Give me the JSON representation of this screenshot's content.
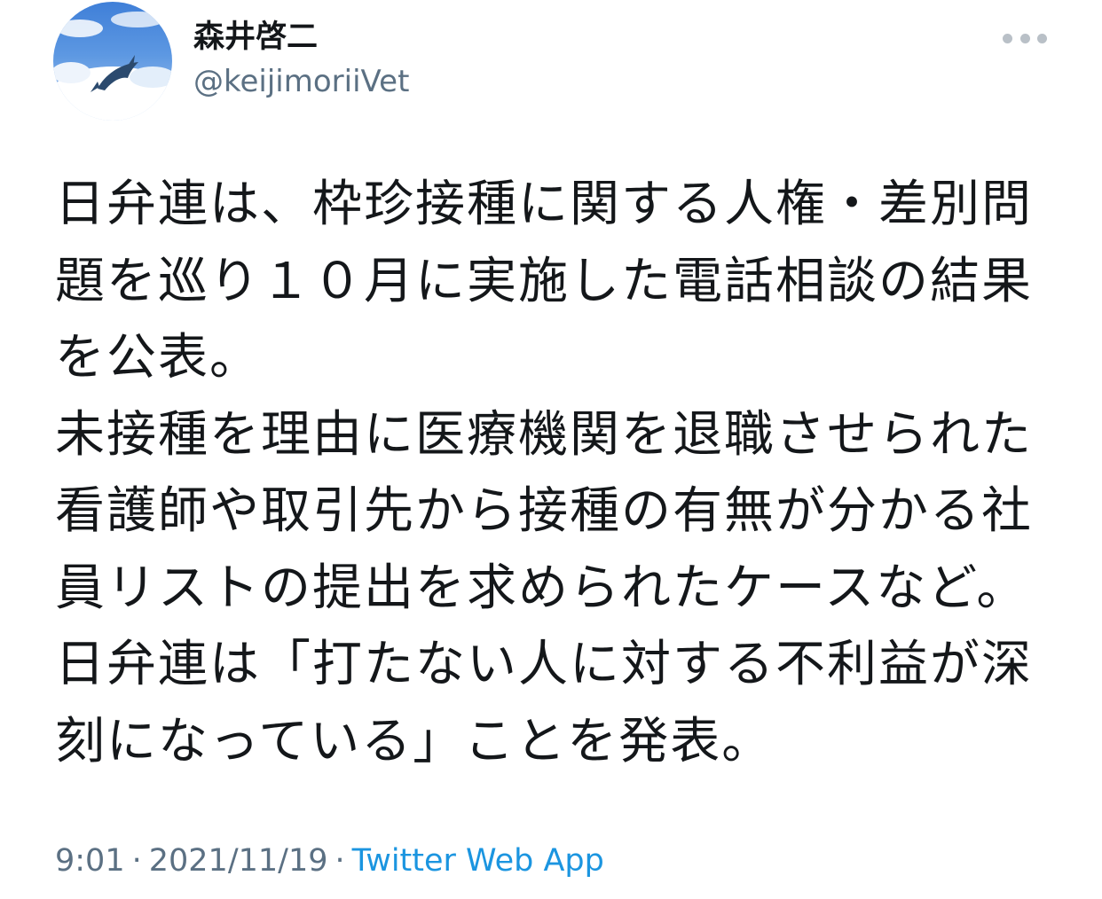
{
  "author": {
    "display_name": "森井啓二",
    "handle": "@keijimoriiVet",
    "avatar_icon": "dolphin-avatar-icon"
  },
  "more_icon": "more-options-icon",
  "tweet": {
    "text": "日弁連は、枠珍接種に関する人権・差別問題を巡り１０月に実施した電話相談の結果を公表。\n未接種を理由に医療機関を退職させられた看護師や取引先から接種の有無が分かる社員リストの提出を求められたケースなど。\n日弁連は「打たない人に対する不利益が深刻になっている」ことを発表。"
  },
  "meta": {
    "time": "9:01",
    "separator": "·",
    "date": "2021/11/19",
    "source": "Twitter Web App"
  },
  "colors": {
    "text": "#14171a",
    "secondary": "#5b7083",
    "link": "#1b95e0",
    "dots": "#b9c0c7"
  }
}
